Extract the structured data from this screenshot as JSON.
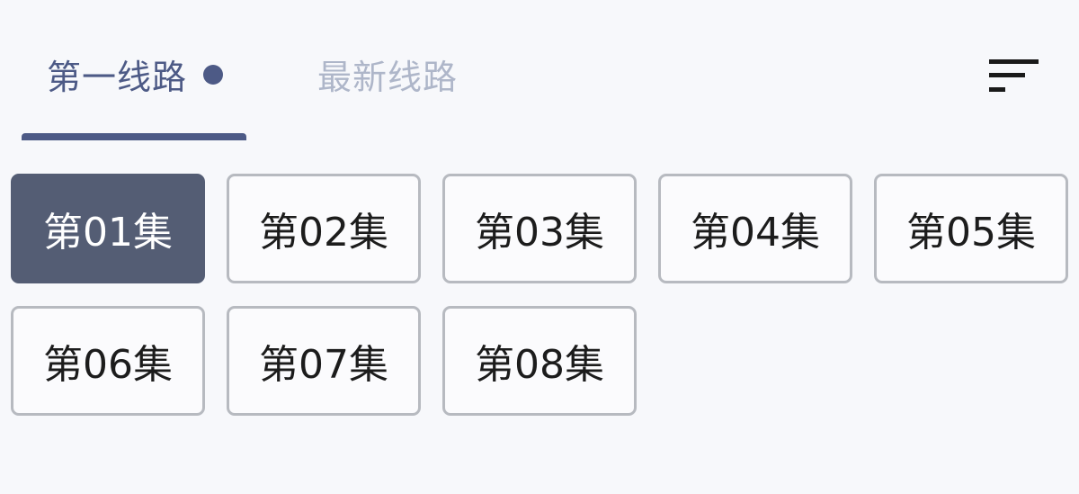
{
  "colors": {
    "active_tab": "#4d5a86",
    "inactive_tab": "#aeb6c9",
    "indicator": "#4d5a86",
    "dot": "#4d5a86",
    "active_episode_bg": "#545d74",
    "episode_border": "#b7bac0",
    "background": "#f7f8fb"
  },
  "tabs": [
    {
      "label": "第一线路",
      "active": true,
      "has_dot": true
    },
    {
      "label": "最新线路",
      "active": false,
      "has_dot": false
    }
  ],
  "sort_button": {
    "icon": "sort-icon"
  },
  "episodes": [
    {
      "label": "第01集",
      "active": true
    },
    {
      "label": "第02集",
      "active": false
    },
    {
      "label": "第03集",
      "active": false
    },
    {
      "label": "第04集",
      "active": false
    },
    {
      "label": "第05集",
      "active": false
    },
    {
      "label": "第06集",
      "active": false
    },
    {
      "label": "第07集",
      "active": false
    },
    {
      "label": "第08集",
      "active": false
    }
  ]
}
